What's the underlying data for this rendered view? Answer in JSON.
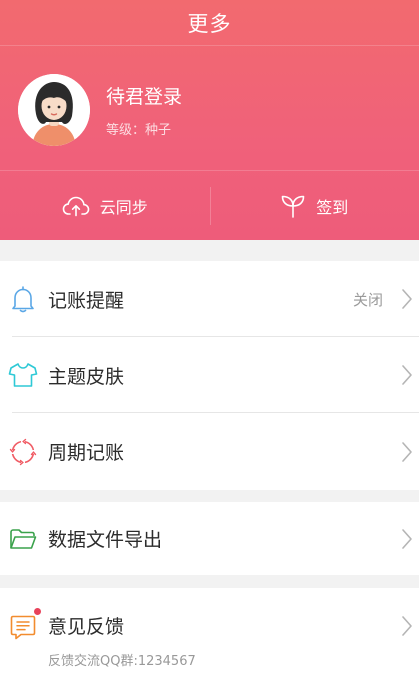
{
  "header": {
    "title": "更多",
    "profile": {
      "name": "待君登录",
      "level": "等级：种子"
    },
    "actions": [
      {
        "label": "云同步",
        "icon": "cloud-upload-icon"
      },
      {
        "label": "签到",
        "icon": "sprout-icon"
      }
    ]
  },
  "menu": {
    "reminder": {
      "label": "记账提醒",
      "value": "关闭",
      "icon": "bell-icon"
    },
    "theme": {
      "label": "主题皮肤",
      "icon": "shirt-icon"
    },
    "cycle": {
      "label": "周期记账",
      "icon": "cycle-icon"
    },
    "export": {
      "label": "数据文件导出",
      "icon": "folder-icon"
    },
    "feedback": {
      "label": "意见反馈",
      "sub": "反馈交流QQ群:1234567",
      "icon": "feedback-icon"
    }
  },
  "colors": {
    "brand_top": "#f26a6f",
    "brand_bottom": "#ee5c7a",
    "bell": "#5aa7e6",
    "shirt": "#2ec9d6",
    "cycle": "#f05b64",
    "folder": "#3aa24b",
    "feedback": "#f28c2e"
  }
}
